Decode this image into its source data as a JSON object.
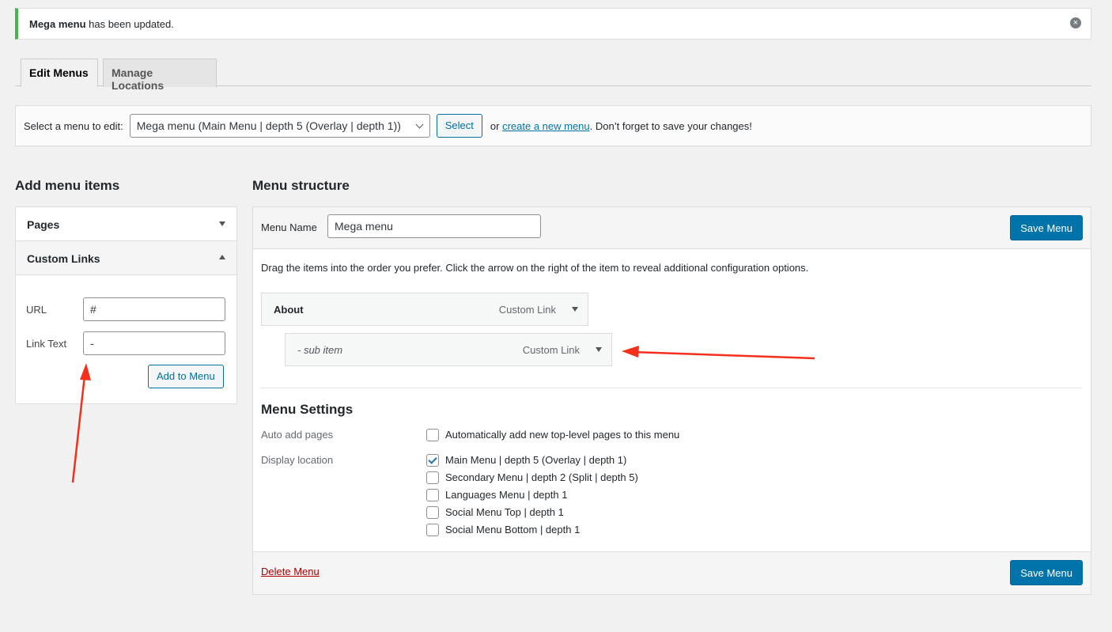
{
  "notice": {
    "bold": "Mega menu",
    "text": " has been updated.",
    "close_icon": "dismiss-icon"
  },
  "tabs": [
    {
      "label": "Edit Menus",
      "active": true
    },
    {
      "label": "Manage Locations",
      "active": false
    }
  ],
  "select_bar": {
    "label": "Select a menu to edit:",
    "selected": "Mega menu (Main Menu | depth 5 (Overlay | depth 1))",
    "button": "Select",
    "or": "or",
    "create_link": "create a new menu",
    "suffix": ". Don’t forget to save your changes!"
  },
  "add_items": {
    "title": "Add menu items",
    "pages": "Pages",
    "custom_links": "Custom Links",
    "url_label": "URL",
    "url_value": "#",
    "link_text_label": "Link Text",
    "link_text_value": "-",
    "add_button": "Add to Menu"
  },
  "structure": {
    "title": "Menu structure",
    "menu_name_label": "Menu Name",
    "menu_name_value": "Mega menu",
    "save": "Save Menu",
    "instructions": "Drag the items into the order you prefer. Click the arrow on the right of the item to reveal additional configuration options.",
    "items": [
      {
        "title": "About",
        "type": "Custom Link",
        "edit": "Edit"
      },
      {
        "title": "-  sub item",
        "type": "Custom Link",
        "edit": "Edit"
      }
    ]
  },
  "settings": {
    "title": "Menu Settings",
    "auto_label": "Auto add pages",
    "auto_option": {
      "label": "Automatically add new top-level pages to this menu",
      "checked": false
    },
    "display_label": "Display location",
    "locations": [
      {
        "label": "Main Menu | depth 5 (Overlay | depth 1)",
        "checked": true
      },
      {
        "label": "Secondary Menu | depth 2 (Split | depth 5)",
        "checked": false
      },
      {
        "label": "Languages Menu | depth 1",
        "checked": false
      },
      {
        "label": "Social Menu Top | depth 1",
        "checked": false
      },
      {
        "label": "Social Menu Bottom | depth 1",
        "checked": false
      }
    ]
  },
  "footer": {
    "delete": "Delete Menu",
    "save": "Save Menu"
  },
  "colors": {
    "accent": "#0073aa",
    "notice": "#46b450",
    "delete": "#a00",
    "annotation_arrow": "#f4301c"
  }
}
